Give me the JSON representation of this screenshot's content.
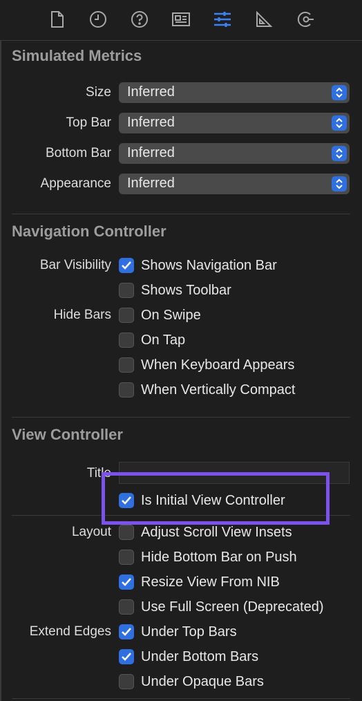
{
  "toolbar": {
    "icons": [
      "file-icon",
      "clock-icon",
      "help-icon",
      "identity-card-icon",
      "sliders-icon",
      "ruler-icon",
      "connections-icon"
    ]
  },
  "simulated_metrics": {
    "title": "Simulated Metrics",
    "rows": [
      {
        "label": "Size",
        "value": "Inferred"
      },
      {
        "label": "Top Bar",
        "value": "Inferred"
      },
      {
        "label": "Bottom Bar",
        "value": "Inferred"
      },
      {
        "label": "Appearance",
        "value": "Inferred"
      }
    ]
  },
  "navigation_controller": {
    "title": "Navigation Controller",
    "bar_visibility_label": "Bar Visibility",
    "hide_bars_label": "Hide Bars",
    "options": [
      {
        "label": "Shows Navigation Bar",
        "checked": true
      },
      {
        "label": "Shows Toolbar",
        "checked": false
      },
      {
        "label": "On Swipe",
        "checked": false
      },
      {
        "label": "On Tap",
        "checked": false
      },
      {
        "label": "When Keyboard Appears",
        "checked": false
      },
      {
        "label": "When Vertically Compact",
        "checked": false
      }
    ]
  },
  "view_controller": {
    "title": "View Controller",
    "title_label": "Title",
    "title_value": "",
    "initial": {
      "label": "Is Initial View Controller",
      "checked": true
    },
    "layout_label": "Layout",
    "extend_edges_label": "Extend Edges",
    "layout_options": [
      {
        "label": "Adjust Scroll View Insets",
        "checked": false
      },
      {
        "label": "Hide Bottom Bar on Push",
        "checked": false
      },
      {
        "label": "Resize View From NIB",
        "checked": true
      },
      {
        "label": "Use Full Screen (Deprecated)",
        "checked": false
      }
    ],
    "edge_options": [
      {
        "label": "Under Top Bars",
        "checked": true
      },
      {
        "label": "Under Bottom Bars",
        "checked": true
      },
      {
        "label": "Under Opaque Bars",
        "checked": false
      }
    ]
  },
  "colors": {
    "accent": "#2f6fe0",
    "highlight": "#7b52ee",
    "background": "#1e1e1e"
  }
}
